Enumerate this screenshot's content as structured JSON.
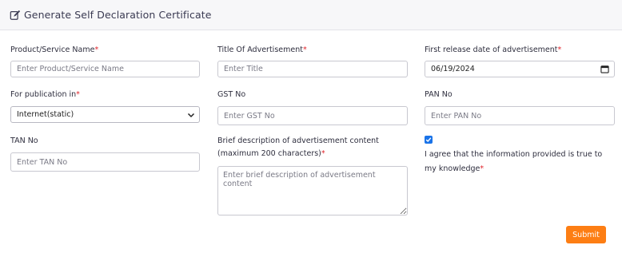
{
  "header": {
    "title": "Generate Self Declaration Certificate",
    "icon": "edit-icon"
  },
  "fields": {
    "product_name": {
      "label": "Product/Service Name",
      "required": "*",
      "placeholder": "Enter Product/Service Name"
    },
    "ad_title": {
      "label": "Title Of Advertisement",
      "required": "*",
      "placeholder": "Enter Title"
    },
    "release_date": {
      "label": "First release date of advertisement",
      "required": "*",
      "value": "06/19/2024",
      "icon": "calendar-icon"
    },
    "publication": {
      "label": "For publication in",
      "required": "*",
      "value": "Internet(static)",
      "icon": "chevron-down-icon"
    },
    "gst": {
      "label": "GST No",
      "placeholder": "Enter GST No"
    },
    "pan": {
      "label": "PAN No",
      "placeholder": "Enter PAN No"
    },
    "tan": {
      "label": "TAN No",
      "placeholder": "Enter TAN No"
    },
    "description": {
      "label_line1": "Brief description of advertisement content",
      "label_line2": "(maximum 200 characters)",
      "required": "*",
      "placeholder": "Enter brief description of advertisement content"
    }
  },
  "agreement": {
    "checked": true,
    "text": "I agree that the information provided is true to my knowledge",
    "required": "*"
  },
  "submit": {
    "label": "Submit"
  },
  "colors": {
    "accent": "#fd7e14",
    "required": "#e0242b",
    "checkbox": "#1a73e8"
  }
}
